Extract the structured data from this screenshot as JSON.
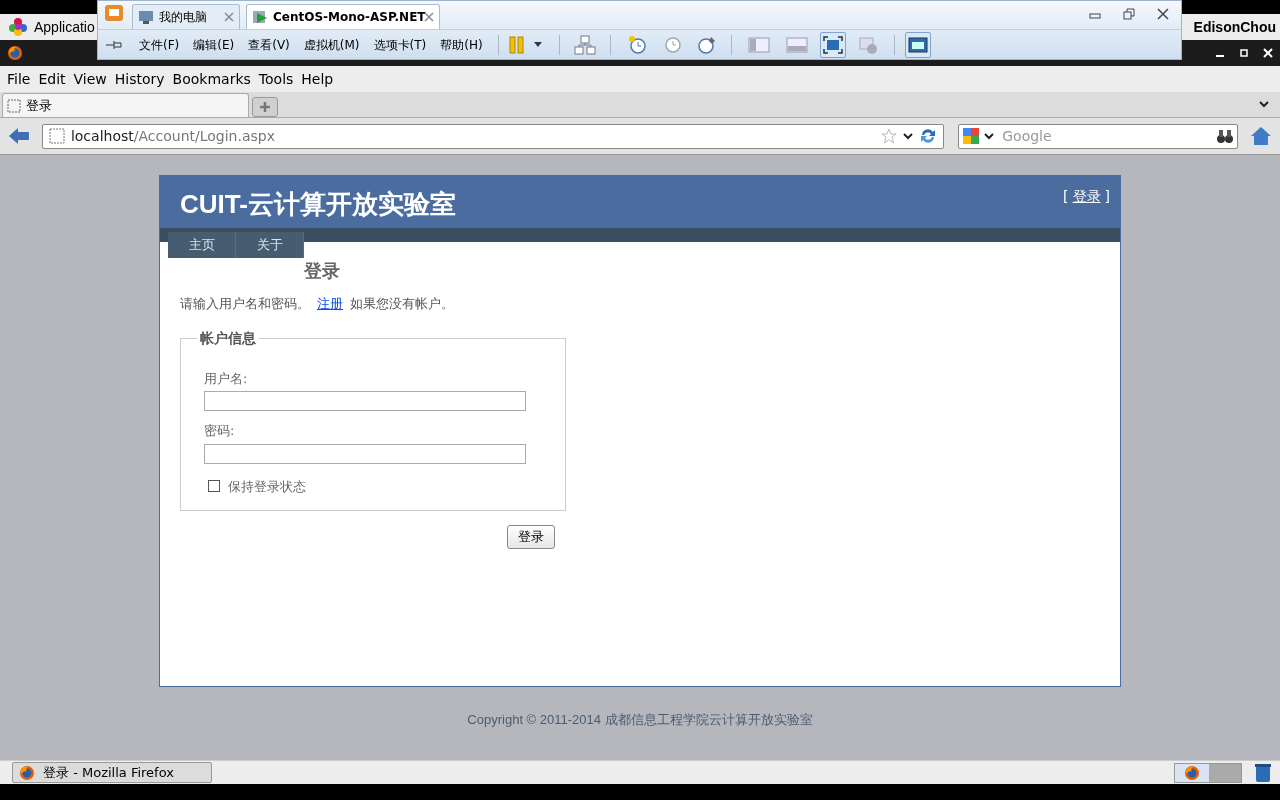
{
  "desktop_panel": {
    "applications": "Applicatio",
    "user": "EdisonChou"
  },
  "vmware": {
    "tabs": [
      {
        "label": "我的电脑",
        "selected": false
      },
      {
        "label": "CentOS-Mono-ASP.NET",
        "selected": true
      }
    ],
    "menu": [
      "文件(F)",
      "编辑(E)",
      "查看(V)",
      "虚拟机(M)",
      "选项卡(T)",
      "帮助(H)"
    ]
  },
  "firefox": {
    "menu": [
      "File",
      "Edit",
      "View",
      "History",
      "Bookmarks",
      "Tools",
      "Help"
    ],
    "tabs": [
      {
        "label": "登录",
        "selected": true
      }
    ],
    "url": {
      "host": "localhost",
      "path": "/Account/Login.aspx"
    },
    "search": {
      "placeholder": "Google"
    }
  },
  "page": {
    "site_title": "CUIT-云计算开放实验室",
    "login_area": {
      "open": "[",
      "link": "登录",
      "close": "]"
    },
    "nav": [
      {
        "label": "主页"
      },
      {
        "label": "关于"
      }
    ],
    "heading": "登录",
    "intro": {
      "before": "请输入用户名和密码。",
      "link": "注册",
      "after": "如果您没有帐户。"
    },
    "fieldset": {
      "legend": "帐户信息",
      "fields": [
        {
          "label": "用户名:"
        },
        {
          "label": "密码:"
        }
      ],
      "remember": {
        "label": "保持登录状态",
        "checked": false
      }
    },
    "submit": "登录",
    "footer": "Copyright © 2011-2014 成都信息工程学院云计算开放实验室"
  },
  "taskbar": {
    "items": [
      {
        "label": "登录 - Mozilla Firefox",
        "selected": false
      }
    ]
  }
}
